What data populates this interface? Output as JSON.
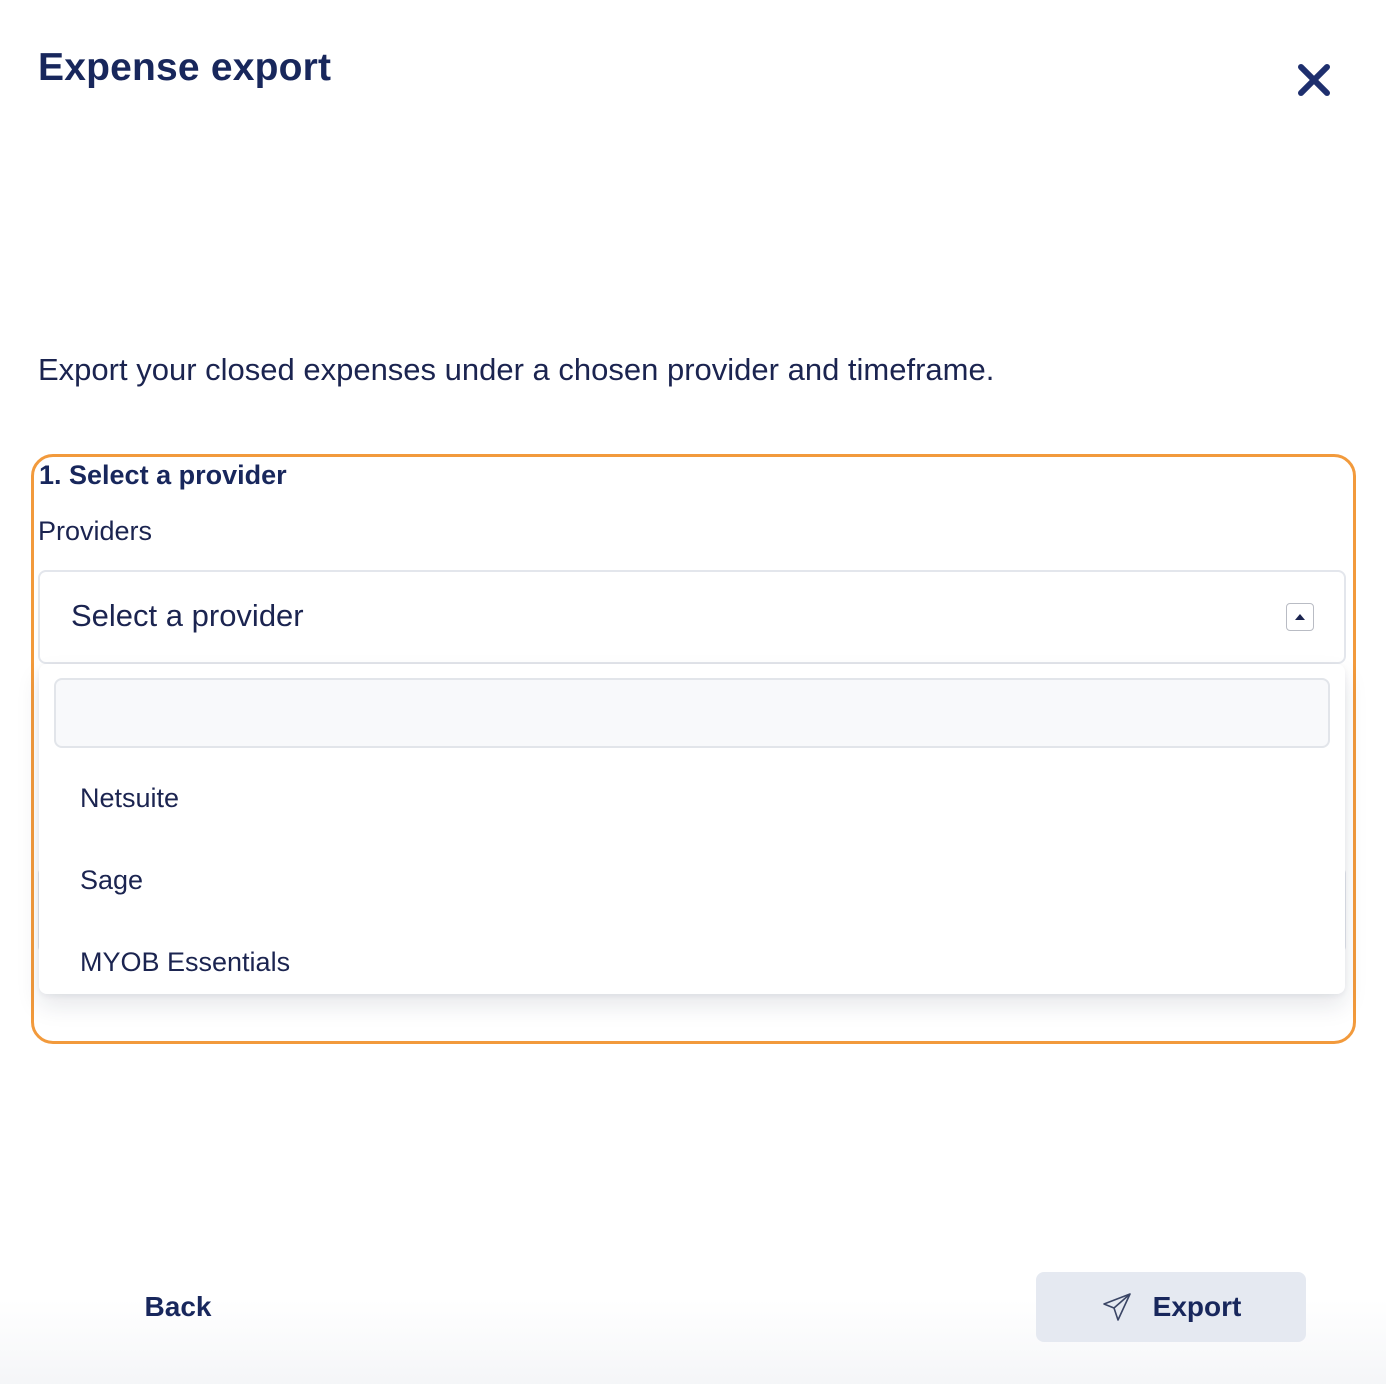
{
  "dialog": {
    "title": "Expense export",
    "close_icon": "close-icon",
    "description": "Export your closed expenses under a chosen provider and timeframe."
  },
  "provider_section": {
    "heading": "1. Select a provider",
    "field_label": "Providers",
    "select": {
      "value": "Select a provider",
      "caret_icon": "caret-up-icon",
      "expanded": true
    },
    "dropdown": {
      "search_value": "",
      "options": [
        "Netsuite",
        "Sage",
        "MYOB Essentials"
      ]
    }
  },
  "colors": {
    "primary_text": "#18275c",
    "highlight_border": "#f29a3c",
    "export_button_bg": "#e5e9f1"
  },
  "footer": {
    "back_label": "Back",
    "export_label": "Export",
    "export_icon": "paper-plane-icon"
  }
}
